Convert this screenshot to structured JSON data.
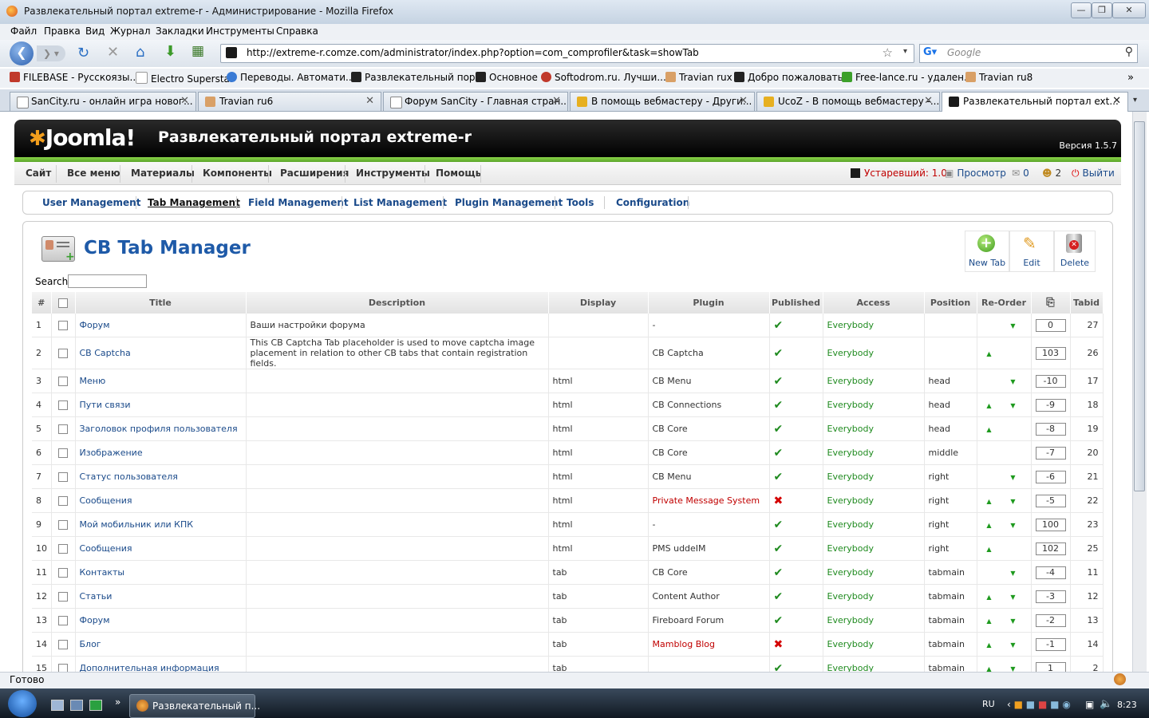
{
  "window": {
    "title": "Развлекательный портал extreme-r - Администрирование - Mozilla Firefox"
  },
  "browser_menu": [
    "Файл",
    "Правка",
    "Вид",
    "Журнал",
    "Закладки",
    "Инструменты",
    "Справка"
  ],
  "address": {
    "url": "http://extreme-r.comze.com/administrator/index.php?option=com_comprofiler&task=showTab",
    "search_placeholder": "Google"
  },
  "bookmarks": [
    "FILEBASE - Русскоязы...",
    "Electro Superstar",
    "Переводы. Автомати...",
    "Развлекательный пор...",
    "Основное",
    "Softodrom.ru. Лучши...",
    "Travian rux",
    "Добро пожаловать!",
    "Free-lance.ru - удален...",
    "Travian ru8"
  ],
  "tabs": [
    {
      "label": "SanCity.ru - онлайн игра новог..."
    },
    {
      "label": "Travian ru6"
    },
    {
      "label": "Форум SanCity - Главная стран..."
    },
    {
      "label": "В помощь вебмастеру - Други..."
    },
    {
      "label": "UcoZ - В помощь вебмастеру -..."
    },
    {
      "label": "Развлекательный портал ext..."
    }
  ],
  "header": {
    "logo": "Joomla!",
    "site_title": "Развлекательный портал extreme-r",
    "version": "Версия 1.5.7"
  },
  "admin_menu": [
    "Сайт",
    "Все меню",
    "Материалы",
    "Компоненты",
    "Расширения",
    "Инструменты",
    "Помощь"
  ],
  "admin_right": {
    "outdated": "Устаревший: 1.0",
    "preview": "Просмотр",
    "messages": "0",
    "users": "2",
    "logout": "Выйти"
  },
  "submenu": [
    "User Management",
    "Tab Management",
    "Field Management",
    "List Management",
    "Plugin Management",
    "Tools",
    "Configuration"
  ],
  "page": {
    "title": "CB Tab Manager",
    "search_label": "Search:"
  },
  "toolbar": {
    "new": "New Tab",
    "edit": "Edit",
    "delete": "Delete"
  },
  "columns": [
    "#",
    "",
    "Title",
    "Description",
    "Display",
    "Plugin",
    "Published",
    "Access",
    "Position",
    "Re-Order",
    "",
    "Tabid"
  ],
  "rows": [
    {
      "n": "1",
      "title": "Форум",
      "desc": "Ваши настройки форума",
      "display": "",
      "plugin": "-",
      "pub": true,
      "access": "Everybody",
      "position": "",
      "up": false,
      "down": true,
      "order": "0",
      "tabid": "27"
    },
    {
      "n": "2",
      "title": "CB Captcha",
      "desc": "This CB Captcha Tab placeholder is used to move captcha image placement in relation to other CB tabs that contain registration fields.",
      "display": "",
      "plugin": "CB Captcha",
      "pub": true,
      "access": "Everybody",
      "position": "",
      "up": true,
      "down": false,
      "order": "103",
      "tabid": "26"
    },
    {
      "n": "3",
      "title": "Меню",
      "desc": "",
      "display": "html",
      "plugin": "CB Menu",
      "pub": true,
      "access": "Everybody",
      "position": "head",
      "up": false,
      "down": true,
      "order": "-10",
      "tabid": "17"
    },
    {
      "n": "4",
      "title": "Пути связи",
      "desc": "",
      "display": "html",
      "plugin": "CB Connections",
      "pub": true,
      "access": "Everybody",
      "position": "head",
      "up": true,
      "down": true,
      "order": "-9",
      "tabid": "18"
    },
    {
      "n": "5",
      "title": "Заголовок профиля пользователя",
      "desc": "",
      "display": "html",
      "plugin": "CB Core",
      "pub": true,
      "access": "Everybody",
      "position": "head",
      "up": true,
      "down": false,
      "order": "-8",
      "tabid": "19"
    },
    {
      "n": "6",
      "title": "Изображение",
      "desc": "",
      "display": "html",
      "plugin": "CB Core",
      "pub": true,
      "access": "Everybody",
      "position": "middle",
      "up": false,
      "down": false,
      "order": "-7",
      "tabid": "20"
    },
    {
      "n": "7",
      "title": "Статус пользователя",
      "desc": "",
      "display": "html",
      "plugin": "CB Menu",
      "pub": true,
      "access": "Everybody",
      "position": "right",
      "up": false,
      "down": true,
      "order": "-6",
      "tabid": "21"
    },
    {
      "n": "8",
      "title": "Сообщения",
      "desc": "",
      "display": "html",
      "plugin": "Private Message System",
      "plugin_red": true,
      "pub": false,
      "access": "Everybody",
      "position": "right",
      "up": true,
      "down": true,
      "order": "-5",
      "tabid": "22"
    },
    {
      "n": "9",
      "title": "Мой мобильник или КПК",
      "desc": "",
      "display": "html",
      "plugin": "-",
      "pub": true,
      "access": "Everybody",
      "position": "right",
      "up": true,
      "down": true,
      "order": "100",
      "tabid": "23"
    },
    {
      "n": "10",
      "title": "Сообщения",
      "desc": "",
      "display": "html",
      "plugin": "PMS uddeIM",
      "pub": true,
      "access": "Everybody",
      "position": "right",
      "up": true,
      "down": false,
      "order": "102",
      "tabid": "25"
    },
    {
      "n": "11",
      "title": "Контакты",
      "desc": "",
      "display": "tab",
      "plugin": "CB Core",
      "pub": true,
      "access": "Everybody",
      "position": "tabmain",
      "up": false,
      "down": true,
      "order": "-4",
      "tabid": "11"
    },
    {
      "n": "12",
      "title": "Статьи",
      "desc": "",
      "display": "tab",
      "plugin": "Content Author",
      "pub": true,
      "access": "Everybody",
      "position": "tabmain",
      "up": true,
      "down": true,
      "order": "-3",
      "tabid": "12"
    },
    {
      "n": "13",
      "title": "Форум",
      "desc": "",
      "display": "tab",
      "plugin": "Fireboard Forum",
      "pub": true,
      "access": "Everybody",
      "position": "tabmain",
      "up": true,
      "down": true,
      "order": "-2",
      "tabid": "13"
    },
    {
      "n": "14",
      "title": "Блог",
      "desc": "",
      "display": "tab",
      "plugin": "Mamblog Blog",
      "plugin_red": true,
      "pub": false,
      "access": "Everybody",
      "position": "tabmain",
      "up": true,
      "down": true,
      "order": "-1",
      "tabid": "14"
    },
    {
      "n": "15",
      "title": "Дополнительная информация",
      "desc": "",
      "display": "tab",
      "plugin": "",
      "pub": true,
      "access": "Everybody",
      "position": "tabmain",
      "up": true,
      "down": true,
      "order": "1",
      "tabid": "2"
    }
  ],
  "status": {
    "text": "Готово"
  },
  "taskbar": {
    "window": "Развлекательный п...",
    "lang": "RU",
    "time": "8:23"
  }
}
